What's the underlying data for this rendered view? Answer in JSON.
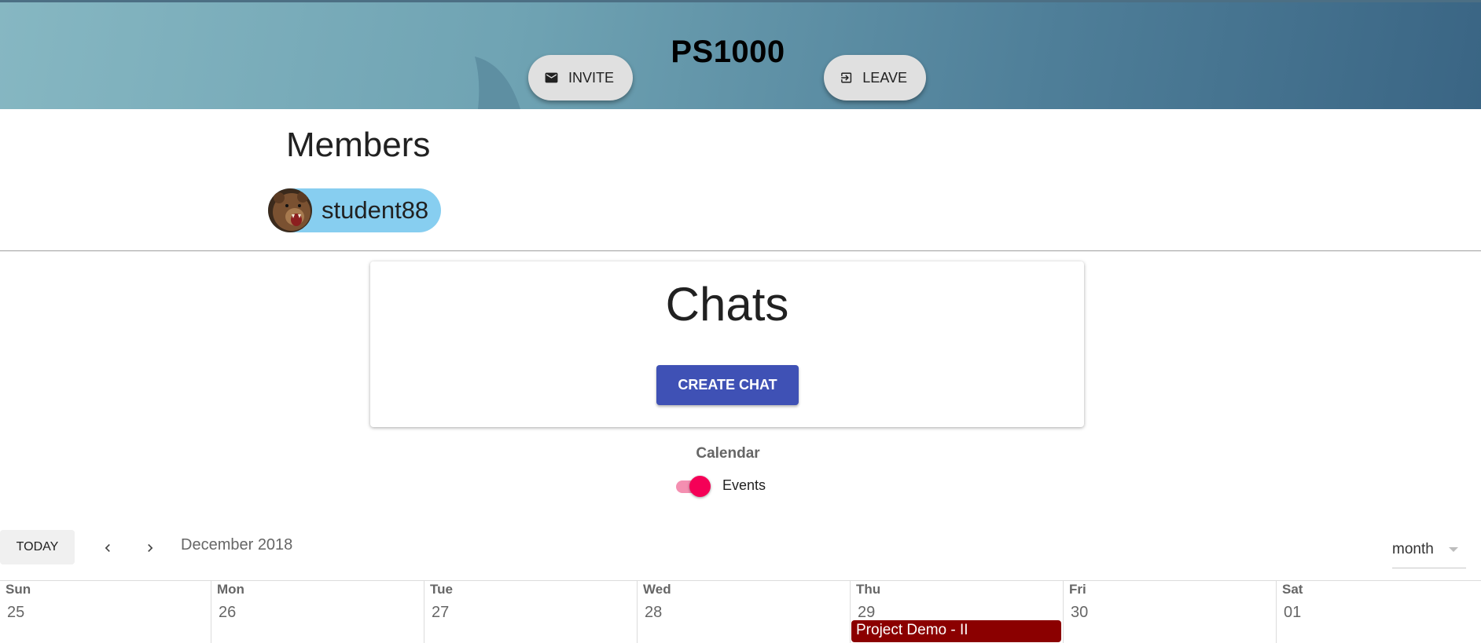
{
  "header": {
    "group_name": "PS1000",
    "invite_label": "INVITE",
    "leave_label": "LEAVE"
  },
  "members": {
    "title": "Members",
    "list": [
      {
        "name": "student88"
      }
    ]
  },
  "chats": {
    "title": "Chats",
    "create_label": "CREATE CHAT"
  },
  "calendar": {
    "title": "Calendar",
    "events_toggle": {
      "label": "Events",
      "on": true
    },
    "today_label": "TODAY",
    "month_label": "December 2018",
    "view": "month",
    "days": [
      {
        "name": "Sun",
        "date": "25"
      },
      {
        "name": "Mon",
        "date": "26"
      },
      {
        "name": "Tue",
        "date": "27"
      },
      {
        "name": "Wed",
        "date": "28"
      },
      {
        "name": "Thu",
        "date": "29"
      },
      {
        "name": "Fri",
        "date": "30"
      },
      {
        "name": "Sat",
        "date": "01"
      }
    ],
    "events": [
      {
        "title": "Project Demo - II",
        "day": "Thu",
        "color": "#8b0000"
      }
    ]
  },
  "colors": {
    "primary": "#3f51b5",
    "accent": "#f50057",
    "member_chip": "#87cef0"
  },
  "icons": {
    "invite": "mail-icon",
    "leave": "exit-icon"
  }
}
